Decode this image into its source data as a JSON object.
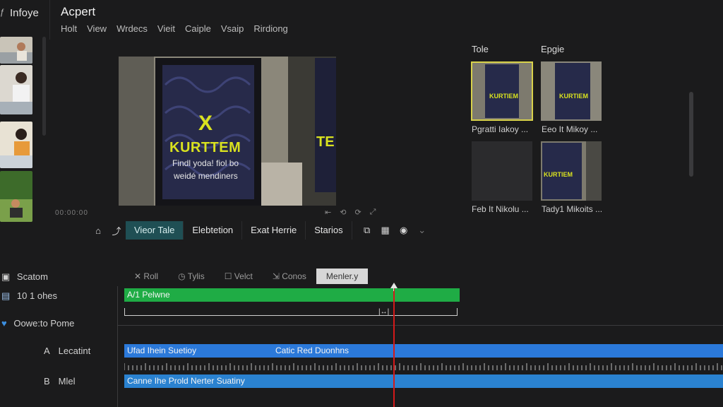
{
  "header": {
    "app_icon": "ƒ",
    "app_name": "Infoye",
    "doc_title": "Acpert",
    "menu": [
      "Holt",
      "View",
      "Wrdecs",
      "Vieit",
      "Caiple",
      "Vsaip",
      "Rirdiong"
    ]
  },
  "preview": {
    "poster_title": "KURTTEM",
    "poster_mark": "X",
    "poster_sub1": "Findl yoda! fiol bo",
    "poster_sub2": "weidé mendiners",
    "side_poster_text": "TE",
    "timecode": "00:00:00",
    "controls": [
      "⇤",
      "⟲",
      "⟳",
      "⤢"
    ]
  },
  "right_panel": {
    "heading_left": "Tole",
    "heading_right": "Epgie",
    "items": [
      {
        "caption": "Pgratti Iakoy ..."
      },
      {
        "caption": "Eeo It Mikoy ..."
      },
      {
        "caption": "Feb It Nikolu ..."
      },
      {
        "caption": "Tady1 Mikoits ..."
      }
    ],
    "poster_title_small": "KURTIEM"
  },
  "toolbar": {
    "icons": [
      "home-icon",
      "magic-wand-icon"
    ],
    "icon_glyphs": [
      "⌂",
      "⤴"
    ],
    "tabs": [
      "Vieor Tale",
      "Elebtetion",
      "Exat Herrie",
      "Starios"
    ],
    "right_icon_glyphs": [
      "⧉",
      "▦",
      "◉",
      "⌄"
    ]
  },
  "timeline": {
    "tracks": [
      {
        "icon": "▣",
        "label": "Scatom"
      },
      {
        "icon": "▤",
        "label": "10 1 ohes"
      },
      {
        "icon": "♥",
        "label": "Oowe:to Pome"
      },
      {
        "prefix": "A",
        "label": "Lecatint"
      },
      {
        "prefix": "B",
        "label": "Mlel"
      }
    ],
    "tabs": [
      {
        "icon": "✕",
        "label": "Roll"
      },
      {
        "icon": "◷",
        "label": "Tylis"
      },
      {
        "icon": "☐",
        "label": "Velct"
      },
      {
        "icon": "⇲",
        "label": "Conos"
      },
      {
        "icon": "",
        "label": "Menler.y"
      }
    ],
    "clips": {
      "green": "A/1 Pelwne",
      "blue1": "Ufad Ihein Suetioy",
      "blue2": "Catic Red Duonhns",
      "blue3": "Canne Ihe Prold Nerter Suatiny"
    },
    "range_marker": "|↔|"
  },
  "colors": {
    "accent_teal": "#1f4f54",
    "clip_green": "#1fac45",
    "clip_blue": "#2b79da",
    "playhead": "#d41a1a",
    "poster_yellow": "#d9e21f"
  }
}
